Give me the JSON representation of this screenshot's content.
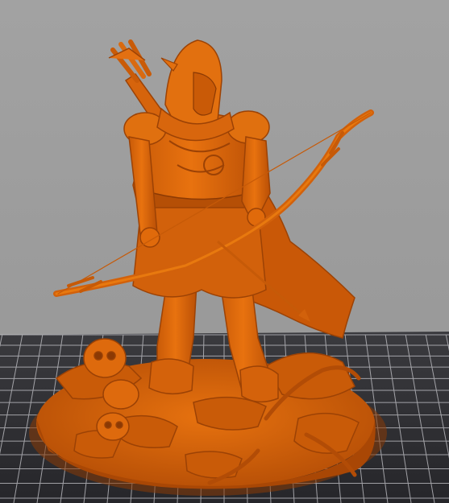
{
  "viewport": {
    "background_color": "#9c9c9c",
    "plate_color": "#2f2f33",
    "grid_color": "#d0d0d4",
    "model_color": "#e06a0b",
    "model_shadow_color": "#a84806",
    "model_highlight_color": "#f08424"
  },
  "model": {
    "icon": "archer-miniature-icon"
  }
}
